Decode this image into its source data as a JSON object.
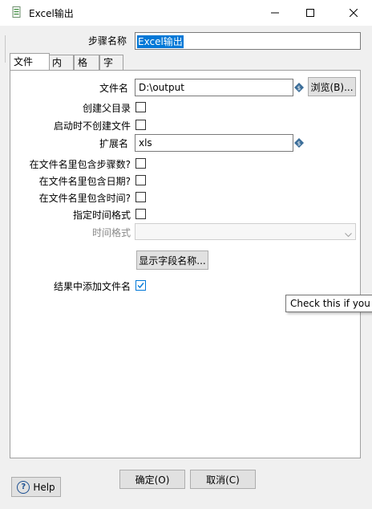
{
  "window": {
    "title": "Excel输出",
    "icon": "excel-output-icon",
    "controls": [
      "minimize-icon",
      "maximize-icon",
      "close-icon"
    ]
  },
  "step": {
    "label": "步骤名称",
    "value": "Excel输出"
  },
  "tabs": [
    {
      "label": "文件",
      "active": true
    },
    {
      "label": "内容",
      "active": false
    },
    {
      "label": "格式",
      "active": false
    },
    {
      "label": "字段",
      "active": false
    }
  ],
  "file_tab": {
    "filename_label": "文件名",
    "filename_value": "D:\\output",
    "browse_label": "浏览(B)...",
    "create_parent_label": "创建父目录",
    "create_parent_checked": false,
    "no_create_on_start_label": "启动时不创建文件",
    "no_create_on_start_checked": false,
    "extension_label": "扩展名",
    "extension_value": "xls",
    "include_stepnr_label": "在文件名里包含步骤数?",
    "include_stepnr_checked": false,
    "include_date_label": "在文件名里包含日期?",
    "include_date_checked": false,
    "include_time_label": "在文件名里包含时间?",
    "include_time_checked": false,
    "specify_time_format_label": "指定时间格式",
    "specify_time_format_checked": false,
    "time_format_label": "时间格式",
    "time_format_value": "",
    "show_filenames_label": "显示字段名称...",
    "add_to_result_label": "结果中添加文件名",
    "add_to_result_checked": true
  },
  "tooltip": {
    "text": "Check this if you w"
  },
  "footer": {
    "help_label": "Help",
    "ok_label": "确定(O)",
    "cancel_label": "取消(C)"
  },
  "colors": {
    "window_bg": "#f0f0f0",
    "selection_blue": "#0078d7",
    "variable_icon": "#3c6e99"
  }
}
